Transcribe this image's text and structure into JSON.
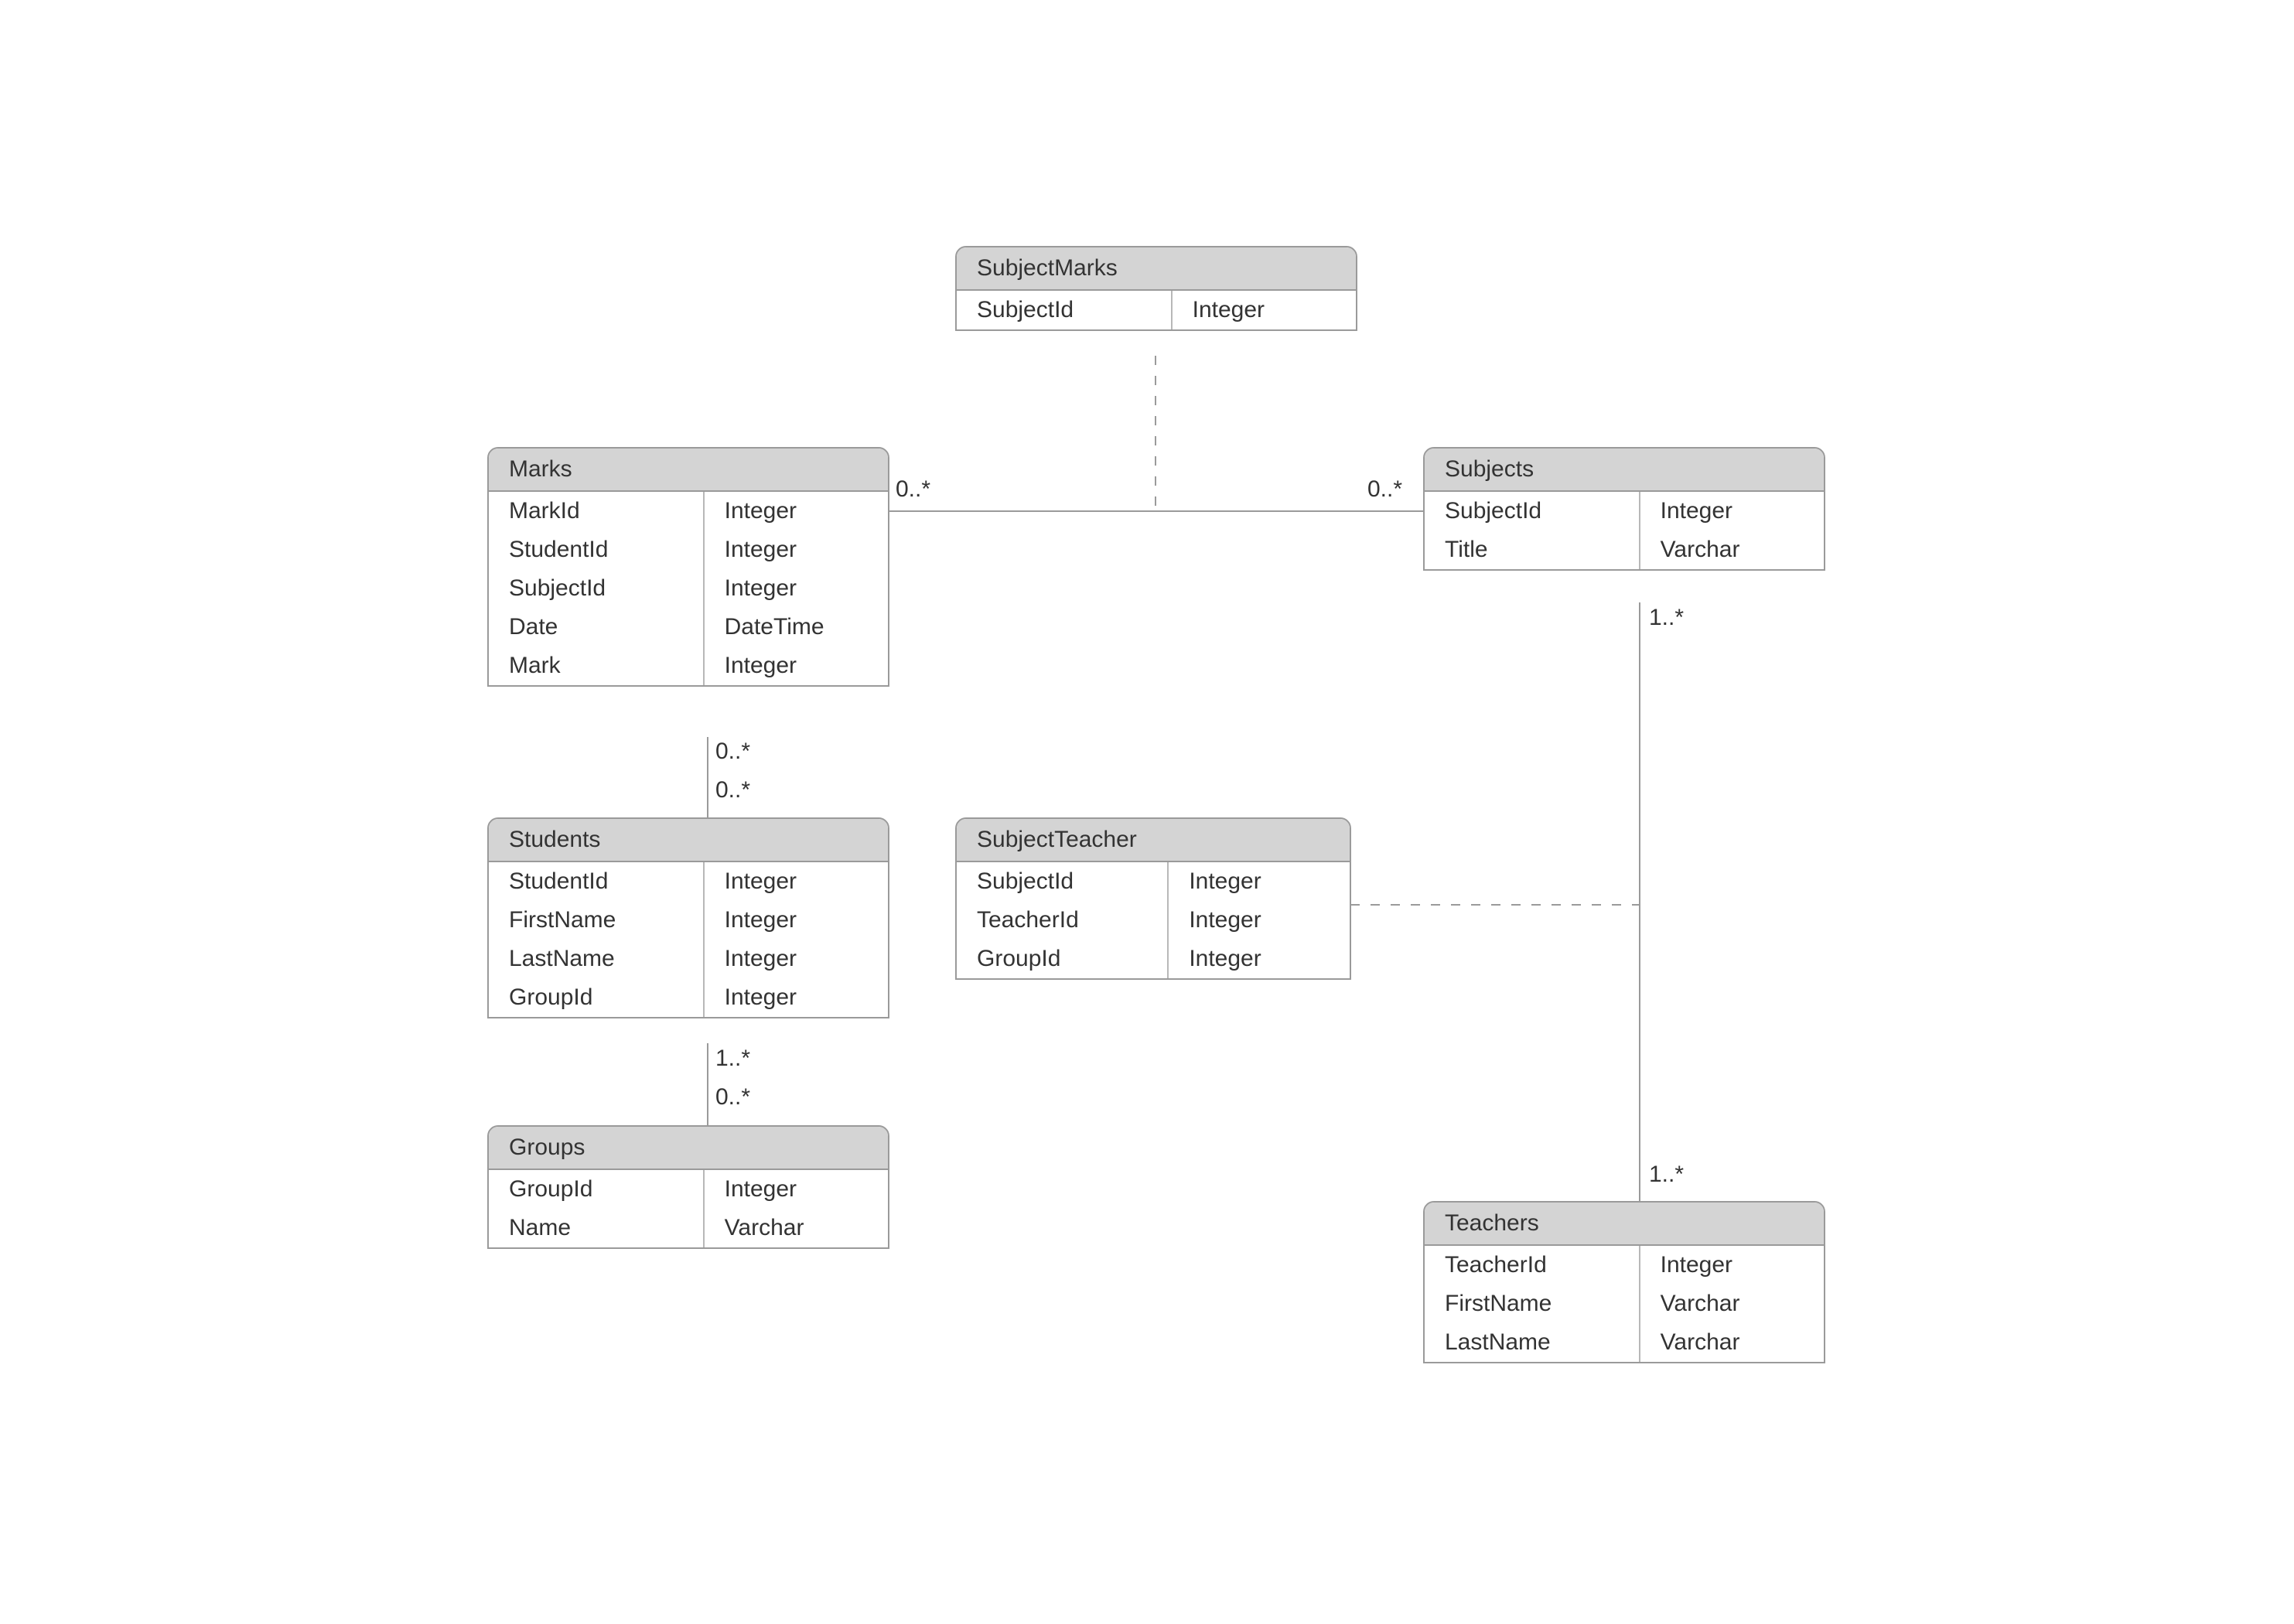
{
  "entities": {
    "subjectMarks": {
      "title": "SubjectMarks",
      "fields": [
        {
          "name": "SubjectId",
          "type": "Integer"
        }
      ]
    },
    "marks": {
      "title": "Marks",
      "fields": [
        {
          "name": "MarkId",
          "type": "Integer"
        },
        {
          "name": "StudentId",
          "type": "Integer"
        },
        {
          "name": "SubjectId",
          "type": "Integer"
        },
        {
          "name": "Date",
          "type": "DateTime"
        },
        {
          "name": "Mark",
          "type": "Integer"
        }
      ]
    },
    "subjects": {
      "title": "Subjects",
      "fields": [
        {
          "name": "SubjectId",
          "type": "Integer"
        },
        {
          "name": "Title",
          "type": "Varchar"
        }
      ]
    },
    "students": {
      "title": "Students",
      "fields": [
        {
          "name": "StudentId",
          "type": "Integer"
        },
        {
          "name": "FirstName",
          "type": "Integer"
        },
        {
          "name": "LastName",
          "type": "Integer"
        },
        {
          "name": "GroupId",
          "type": "Integer"
        }
      ]
    },
    "subjectTeacher": {
      "title": "SubjectTeacher",
      "fields": [
        {
          "name": "SubjectId",
          "type": "Integer"
        },
        {
          "name": "TeacherId",
          "type": "Integer"
        },
        {
          "name": "GroupId",
          "type": "Integer"
        }
      ]
    },
    "groups": {
      "title": "Groups",
      "fields": [
        {
          "name": "GroupId",
          "type": "Integer"
        },
        {
          "name": "Name",
          "type": "Varchar"
        }
      ]
    },
    "teachers": {
      "title": "Teachers",
      "fields": [
        {
          "name": "TeacherId",
          "type": "Integer"
        },
        {
          "name": "FirstName",
          "type": "Varchar"
        },
        {
          "name": "LastName",
          "type": "Varchar"
        }
      ]
    }
  },
  "cardinalities": {
    "marksToSubjectsLeft": "0..*",
    "marksToSubjectsRight": "0..*",
    "marksToStudentsTop": "0..*",
    "marksToStudentsBottom": "0..*",
    "subjectsToTeachersTop": "1..*",
    "subjectsToTeachersBottom": "1..*",
    "studentsToGroupsTop": "1..*",
    "studentsToGroupsBottom": "0..*"
  }
}
